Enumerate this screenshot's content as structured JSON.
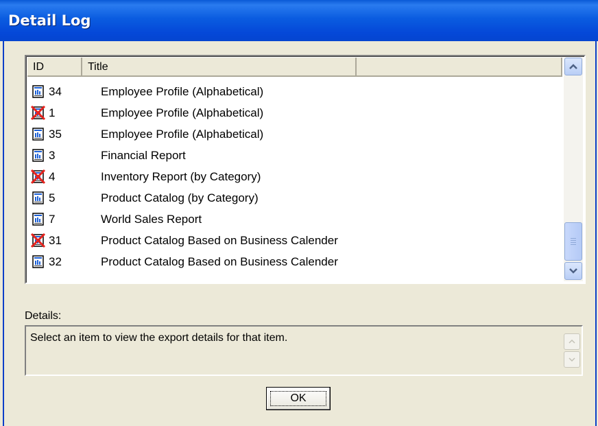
{
  "window": {
    "title": "Detail Log"
  },
  "list": {
    "columns": [
      "ID",
      "Title",
      ""
    ],
    "rows": [
      {
        "id": "34",
        "title": "Employee Profile (Alphabetical)",
        "status": "ok"
      },
      {
        "id": "1",
        "title": "Employee Profile (Alphabetical)",
        "status": "failed"
      },
      {
        "id": "35",
        "title": "Employee Profile (Alphabetical)",
        "status": "ok"
      },
      {
        "id": "3",
        "title": "Financial Report",
        "status": "ok"
      },
      {
        "id": "4",
        "title": "Inventory Report (by Category)",
        "status": "failed"
      },
      {
        "id": "5",
        "title": "Product Catalog (by Category)",
        "status": "ok"
      },
      {
        "id": "7",
        "title": "World Sales Report",
        "status": "ok"
      },
      {
        "id": "31",
        "title": "Product Catalog Based on Business Calender",
        "status": "failed"
      },
      {
        "id": "32",
        "title": "Product Catalog Based on Business Calender",
        "status": "ok"
      }
    ],
    "icons": {
      "ok": "report-icon",
      "failed": "report-failed-icon"
    }
  },
  "details": {
    "label": "Details:",
    "text": "Select an item to view the export details for that item."
  },
  "buttons": {
    "ok": "OK"
  }
}
